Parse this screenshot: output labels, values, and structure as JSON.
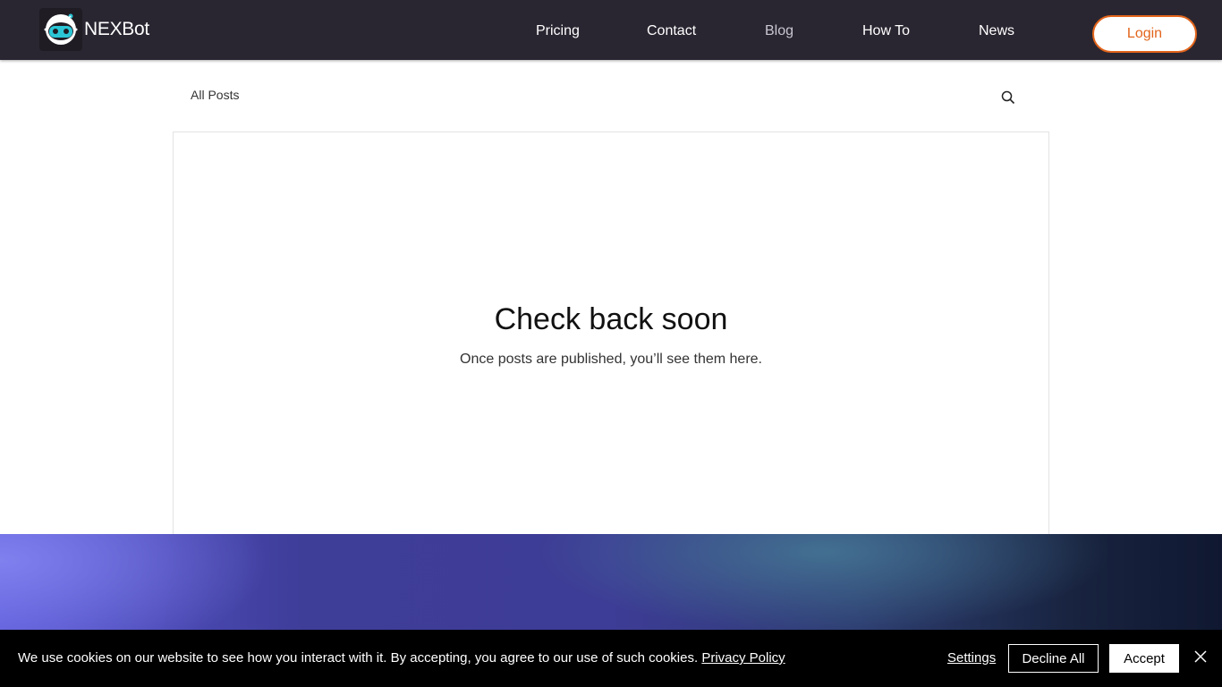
{
  "header": {
    "brand": "NEXBot",
    "nav": [
      {
        "label": "Pricing",
        "active": false
      },
      {
        "label": "Contact",
        "active": false
      },
      {
        "label": "Blog",
        "active": true
      },
      {
        "label": "How To",
        "active": false
      },
      {
        "label": "News",
        "active": false
      }
    ],
    "login_label": "Login",
    "accent_color": "#e2641b",
    "bg_color": "#2a2631"
  },
  "blog": {
    "all_posts_label": "All Posts",
    "search_icon": "search-icon",
    "empty_title": "Check back soon",
    "empty_subtitle": "Once posts are published, you’ll see them here."
  },
  "cookie_bar": {
    "text": "We use cookies on our website to see how you interact with it. By accepting, you agree to our use of such cookies.",
    "privacy_link": "Privacy Policy",
    "settings_label": "Settings",
    "decline_label": "Decline All",
    "accept_label": "Accept",
    "close_icon": "close-icon"
  }
}
